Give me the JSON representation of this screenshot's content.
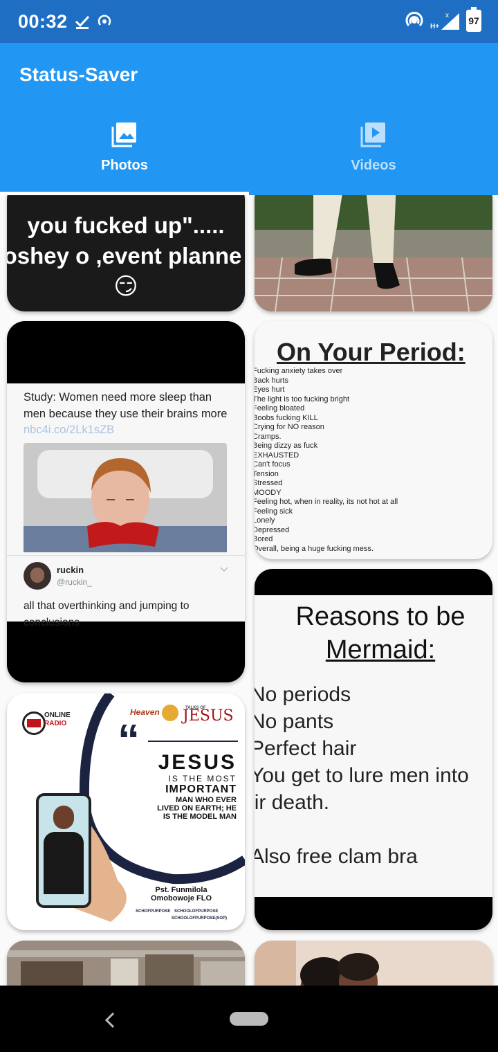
{
  "status_bar": {
    "time": "00:32",
    "battery": "97"
  },
  "app": {
    "title": "Status-Saver"
  },
  "tabs": [
    {
      "label": "Photos",
      "icon": "photo-library-icon",
      "active": true
    },
    {
      "label": "Videos",
      "icon": "video-library-icon",
      "active": false
    }
  ],
  "cards": {
    "meme1": {
      "line1": "you fucked up\".....",
      "line2": "oshey o ,event planne",
      "emoji": "😏"
    },
    "tweet": {
      "headline": "Study: Women need more sleep than men because they use their brains more",
      "link": "nbc4i.co/2Lk1sZB",
      "user_name": "ruckin",
      "user_handle": "@ruckin_",
      "reply": "all that overthinking and jumping to conclusions"
    },
    "period": {
      "title": "On Your Period:",
      "lines": [
        "Fucking anxiety takes over",
        "Back hurts",
        "Eyes hurt",
        "The light is too fucking bright",
        "Feeling bloated",
        "Boobs fucking KILL",
        "Crying for NO reason",
        "Cramps.",
        "Being dizzy as fuck",
        "EXHAUSTED",
        "Can't focus",
        "Tension",
        "Stressed",
        "MOODY",
        "Feeling hot, when in reality, its not hot at all",
        "Feeling sick",
        "Lonely",
        "Depressed",
        "Bored",
        "Overall, being a huge fucking mess."
      ]
    },
    "mermaid": {
      "title_line1": "Reasons to be",
      "title_line2": "Mermaid:",
      "items": [
        "No periods",
        "No pants",
        "Perfect hair",
        "You get to lure men into",
        "their death.",
        "",
        "Also free clam bra"
      ]
    },
    "jesus": {
      "radio1": "ONLINE",
      "radio2": "RADIO",
      "brand": "JESUS",
      "brand_small": "TALKS OF",
      "heaven": "Heaven",
      "quote_mark": "“",
      "big": "JESUS",
      "is_the_most": "IS THE MOST",
      "important": "IMPORTANT",
      "rest1": "MAN WHO EVER",
      "rest2": "LIVED ON EARTH; HE",
      "rest3": "IS THE MODEL MAN",
      "speaker1": "Pst. Funmilola",
      "speaker2": "Omobowoje FLO",
      "social1": "SCHOFPURPOSE",
      "social2": "SCHOOLOFPURPOSE",
      "social3": "SCHOOLOFPURPOSE(SOP)"
    }
  },
  "colors": {
    "status_bar": "#1e6fc4",
    "app_bar": "#2196f3",
    "nav_bar": "#000000"
  }
}
